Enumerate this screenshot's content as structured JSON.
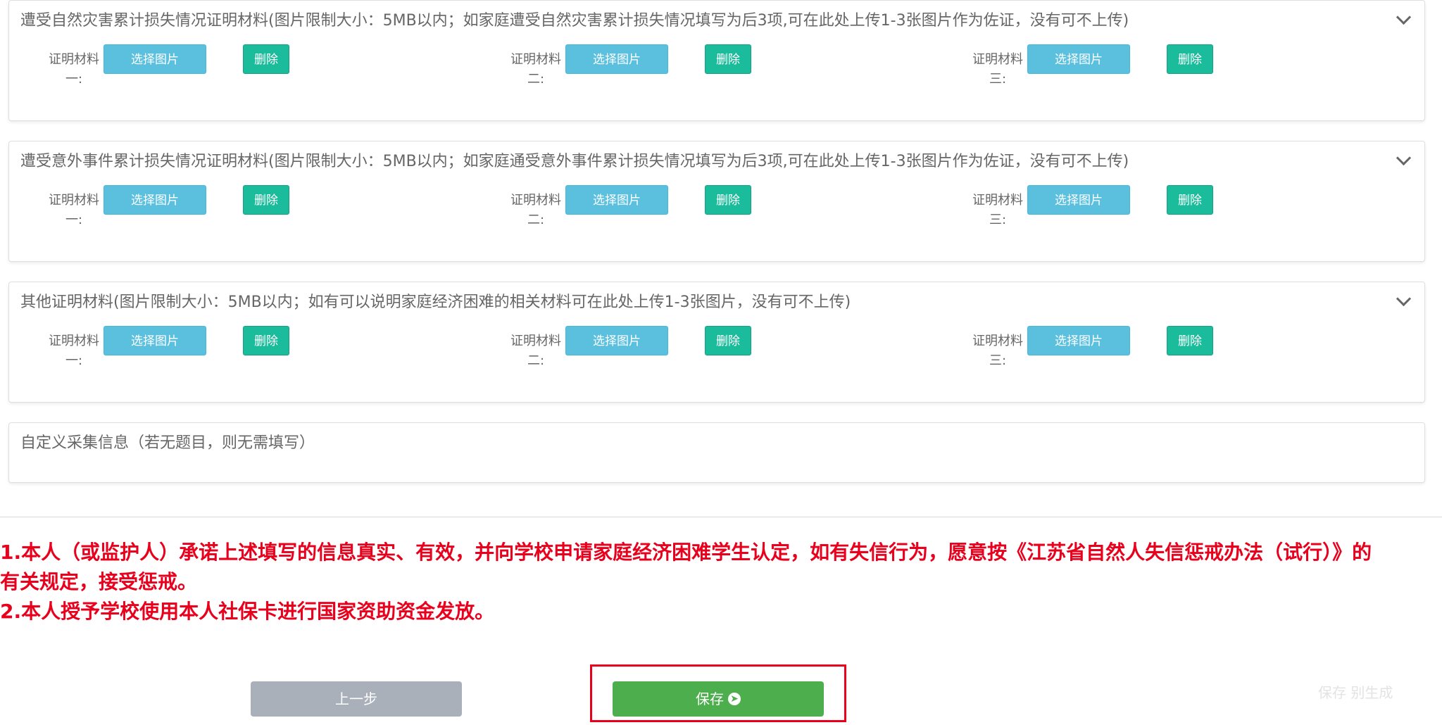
{
  "sections": [
    {
      "title": "遭受自然灾害累计损失情况证明材料(图片限制大小：5MB以内；如家庭遭受自然灾害累计损失情况填写为后3项,可在此处上传1-3张图片作为佐证，没有可不上传)",
      "uploads": [
        {
          "label": "证明材料一:",
          "select": "选择图片",
          "delete": "删除"
        },
        {
          "label": "证明材料二:",
          "select": "选择图片",
          "delete": "删除"
        },
        {
          "label": "证明材料三:",
          "select": "选择图片",
          "delete": "删除"
        }
      ]
    },
    {
      "title": "遭受意外事件累计损失情况证明材料(图片限制大小：5MB以内；如家庭通受意外事件累计损失情况填写为后3项,可在此处上传1-3张图片作为佐证，没有可不上传)",
      "uploads": [
        {
          "label": "证明材料一:",
          "select": "选择图片",
          "delete": "删除"
        },
        {
          "label": "证明材料二:",
          "select": "选择图片",
          "delete": "删除"
        },
        {
          "label": "证明材料三:",
          "select": "选择图片",
          "delete": "删除"
        }
      ]
    },
    {
      "title": "其他证明材料(图片限制大小：5MB以内；如有可以说明家庭经济困难的相关材料可在此处上传1-3张图片，没有可不上传)",
      "uploads": [
        {
          "label": "证明材料一:",
          "select": "选择图片",
          "delete": "删除"
        },
        {
          "label": "证明材料二:",
          "select": "选择图片",
          "delete": "删除"
        },
        {
          "label": "证明材料三:",
          "select": "选择图片",
          "delete": "删除"
        }
      ]
    }
  ],
  "custom_info": {
    "title": "自定义采集信息（若无题目，则无需填写）"
  },
  "notice": {
    "line1": " 1.本人（或监护人）承诺上述填写的信息真实、有效，并向学校申请家庭经济困难学生认定，如有失信行为，愿意按《江苏省自然人失信惩戒办法（试行）》的",
    "line2": "有关规定，接受惩戒。",
    "line3": " 2.本人授予学校使用本人社保卡进行国家资助资金发放。"
  },
  "buttons": {
    "prev": "上一步",
    "save": "保存"
  },
  "watermark": "保存 别生成",
  "colors": {
    "select_button": "#5bc0de",
    "delete_button": "#1abc9c",
    "save_button": "#4cae4c",
    "prev_button": "#aab0ba",
    "notice_text": "#e8001c"
  }
}
